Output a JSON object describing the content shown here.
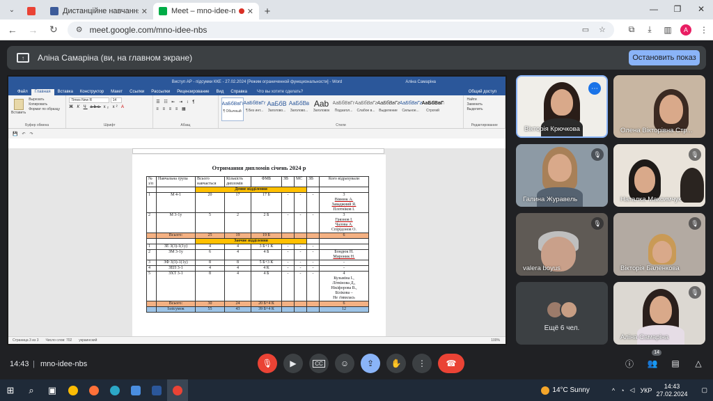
{
  "browser": {
    "tabs": [
      {
        "icon": "gmail-icon",
        "title": "",
        "color": "#ea4335"
      },
      {
        "icon": "moodle-icon",
        "title": "Дистанційне навчання в ВСП",
        "color": "#3c5b9a"
      },
      {
        "icon": "meet-icon",
        "title": "Meet – mno-idee-nbs",
        "color": "#00ac47"
      }
    ],
    "url": "meet.google.com/mno-idee-nbs",
    "profile_initial": "A"
  },
  "banner": {
    "text": "Аліна Самаріна (ви, на главном экране)",
    "stop_label": "Остановить показ"
  },
  "word": {
    "title": "Виступ АР - підсумки ККЕ - 27.02.2024 [Режим ограниченной функциональности] - Word",
    "user": "Аліна Самаріна",
    "menu": [
      "Файл",
      "Главная",
      "Вставка",
      "Конструктор",
      "Макет",
      "Ссылки",
      "Рассылки",
      "Рецензирование",
      "Вид",
      "Справка"
    ],
    "tell_me": "Что вы хотите сделать?",
    "share": "Общий доступ",
    "clipboard": {
      "paste": "Вставить",
      "cut": "Вырезать",
      "copy": "Копировать",
      "format": "Формат по образцу",
      "group": "Буфер обмена"
    },
    "font": {
      "name": "Times New R",
      "size": "14",
      "group": "Шрифт"
    },
    "para_group": "Абзац",
    "styles": [
      {
        "preview": "АаБбВвГг",
        "name": "¶ Обычный"
      },
      {
        "preview": "АаБбВвГг",
        "name": "¶ Без инт..."
      },
      {
        "preview": "АаБбВ",
        "name": "Заголово..."
      },
      {
        "preview": "АаБбВв",
        "name": "Заголово..."
      },
      {
        "preview": "Aab",
        "name": "Заголовок"
      },
      {
        "preview": "АаБбВвГг",
        "name": "Подзагол..."
      },
      {
        "preview": "АаБбВвГг",
        "name": "Слабое в..."
      },
      {
        "preview": "АаБбВвГг",
        "name": "Выделение"
      },
      {
        "preview": "АаБбВвГг",
        "name": "Сильное..."
      },
      {
        "preview": "АаБбВвГг",
        "name": "Строгий"
      }
    ],
    "styles_group": "Стили",
    "edit": {
      "find": "Найти",
      "replace": "Заменить",
      "select": "Выделить",
      "group": "Редактирование"
    },
    "status": {
      "page": "Страница 3 из 3",
      "words": "Число слов: 702",
      "lang": "украинский",
      "zoom": "100%"
    },
    "doc": {
      "title": "Отримання дипломів січень 2024 р",
      "headers": [
        "№ з/п",
        "Навчальна група",
        "Всього навчається",
        "Кількість дипломів",
        "ФМБ",
        "ЗВ",
        "МС",
        "ЗВ",
        "Кого відрахували"
      ],
      "section_day": "Денне відділення",
      "section_ext": "Заочне відділення",
      "day_rows": [
        {
          "n": "1",
          "group": "М 4-1",
          "total": "20",
          "dipl": "17",
          "fmb": "17 Б",
          "zv": "-",
          "ms": "-",
          "zv2": "-",
          "exp": [
            "3",
            "Вівнюк А.",
            "Заваджний Я.",
            "Плотніков І."
          ]
        },
        {
          "n": "2",
          "group": "М 3-1у",
          "total": "5",
          "dipl": "2",
          "fmb": "2 Б",
          "zv": "-",
          "ms": "-",
          "zv2": "-",
          "exp": [
            "3",
            "Грязнов І.",
            "Чалова А.",
            "Спірідонов О."
          ]
        }
      ],
      "day_total": {
        "label": "Всього:",
        "total": "25",
        "dipl": "19",
        "fmb": "19 Б",
        "exp": "6"
      },
      "ext_rows": [
        {
          "n": "1",
          "group": "ЗЕ 3(3)-1(1у)",
          "total": "4",
          "dipl": "4",
          "fmb": "3 Б+1 К",
          "zv": "-",
          "ms": "-",
          "zv2": "-",
          "exp": []
        },
        {
          "n": "2",
          "group": "ЗМ 3-1у",
          "total": "6",
          "dipl": "4",
          "fmb": "4 Б",
          "zv": "-",
          "ms": "-",
          "zv2": "-",
          "exp": [
            "Бондюк Н.",
            "Мироник Н."
          ]
        },
        {
          "n": "3",
          "group": "ЗФ 3(3)-1(1у)",
          "total": "8",
          "dipl": "8",
          "fmb": "5 Б+3 К",
          "zv": "-",
          "ms": "-",
          "zv2": "-",
          "exp": [
            "-"
          ]
        },
        {
          "n": "4",
          "group": "ЗЕП 3-1",
          "total": "4",
          "dipl": "4",
          "fmb": "4 К",
          "zv": "-",
          "ms": "-",
          "zv2": "-",
          "exp": [
            "-"
          ]
        },
        {
          "n": "5",
          "group": "ЗХТ 3-1",
          "total": "8",
          "dipl": "4",
          "fmb": "4 Б",
          "zv": "-",
          "ms": "-",
          "zv2": "-",
          "exp": [
            "4",
            "Кузьміна І.,",
            "Літвінова Д.,",
            "Нікіфорова В.,",
            "Білікова –",
            "Не з'явилась"
          ]
        }
      ],
      "ext_total": {
        "label": "Всього:",
        "total": "30",
        "dipl": "24",
        "fmb": "20 Б+4 К",
        "exp": "6"
      },
      "grand_total": {
        "label": "Ізлісумок",
        "total": "55",
        "dipl": "43",
        "fmb": "39 Б+4 К",
        "exp": "12"
      }
    }
  },
  "participants": [
    {
      "name": "Вікторія Крючкова",
      "muted": false,
      "active": true
    },
    {
      "name": "Олена Вікторівна Стр...",
      "muted": false,
      "active": false
    },
    {
      "name": "Галина Журавель",
      "muted": true,
      "active": false
    },
    {
      "name": "Наталка Максимчук",
      "muted": true,
      "active": false
    },
    {
      "name": "valera boyus",
      "muted": true,
      "active": false
    },
    {
      "name": "Вікторія Баленкова",
      "muted": true,
      "active": false
    },
    {
      "name": "Аліна Самаріна",
      "muted": true,
      "active": false
    }
  ],
  "more_participants": "Ещё 6 чел.",
  "meet_bar": {
    "time": "14:43",
    "code": "mno-idee-nbs",
    "participant_count": "14"
  },
  "taskbar": {
    "weather": "14°C  Sunny",
    "lang": "УКР",
    "time": "14:43",
    "date": "27.02.2024"
  }
}
